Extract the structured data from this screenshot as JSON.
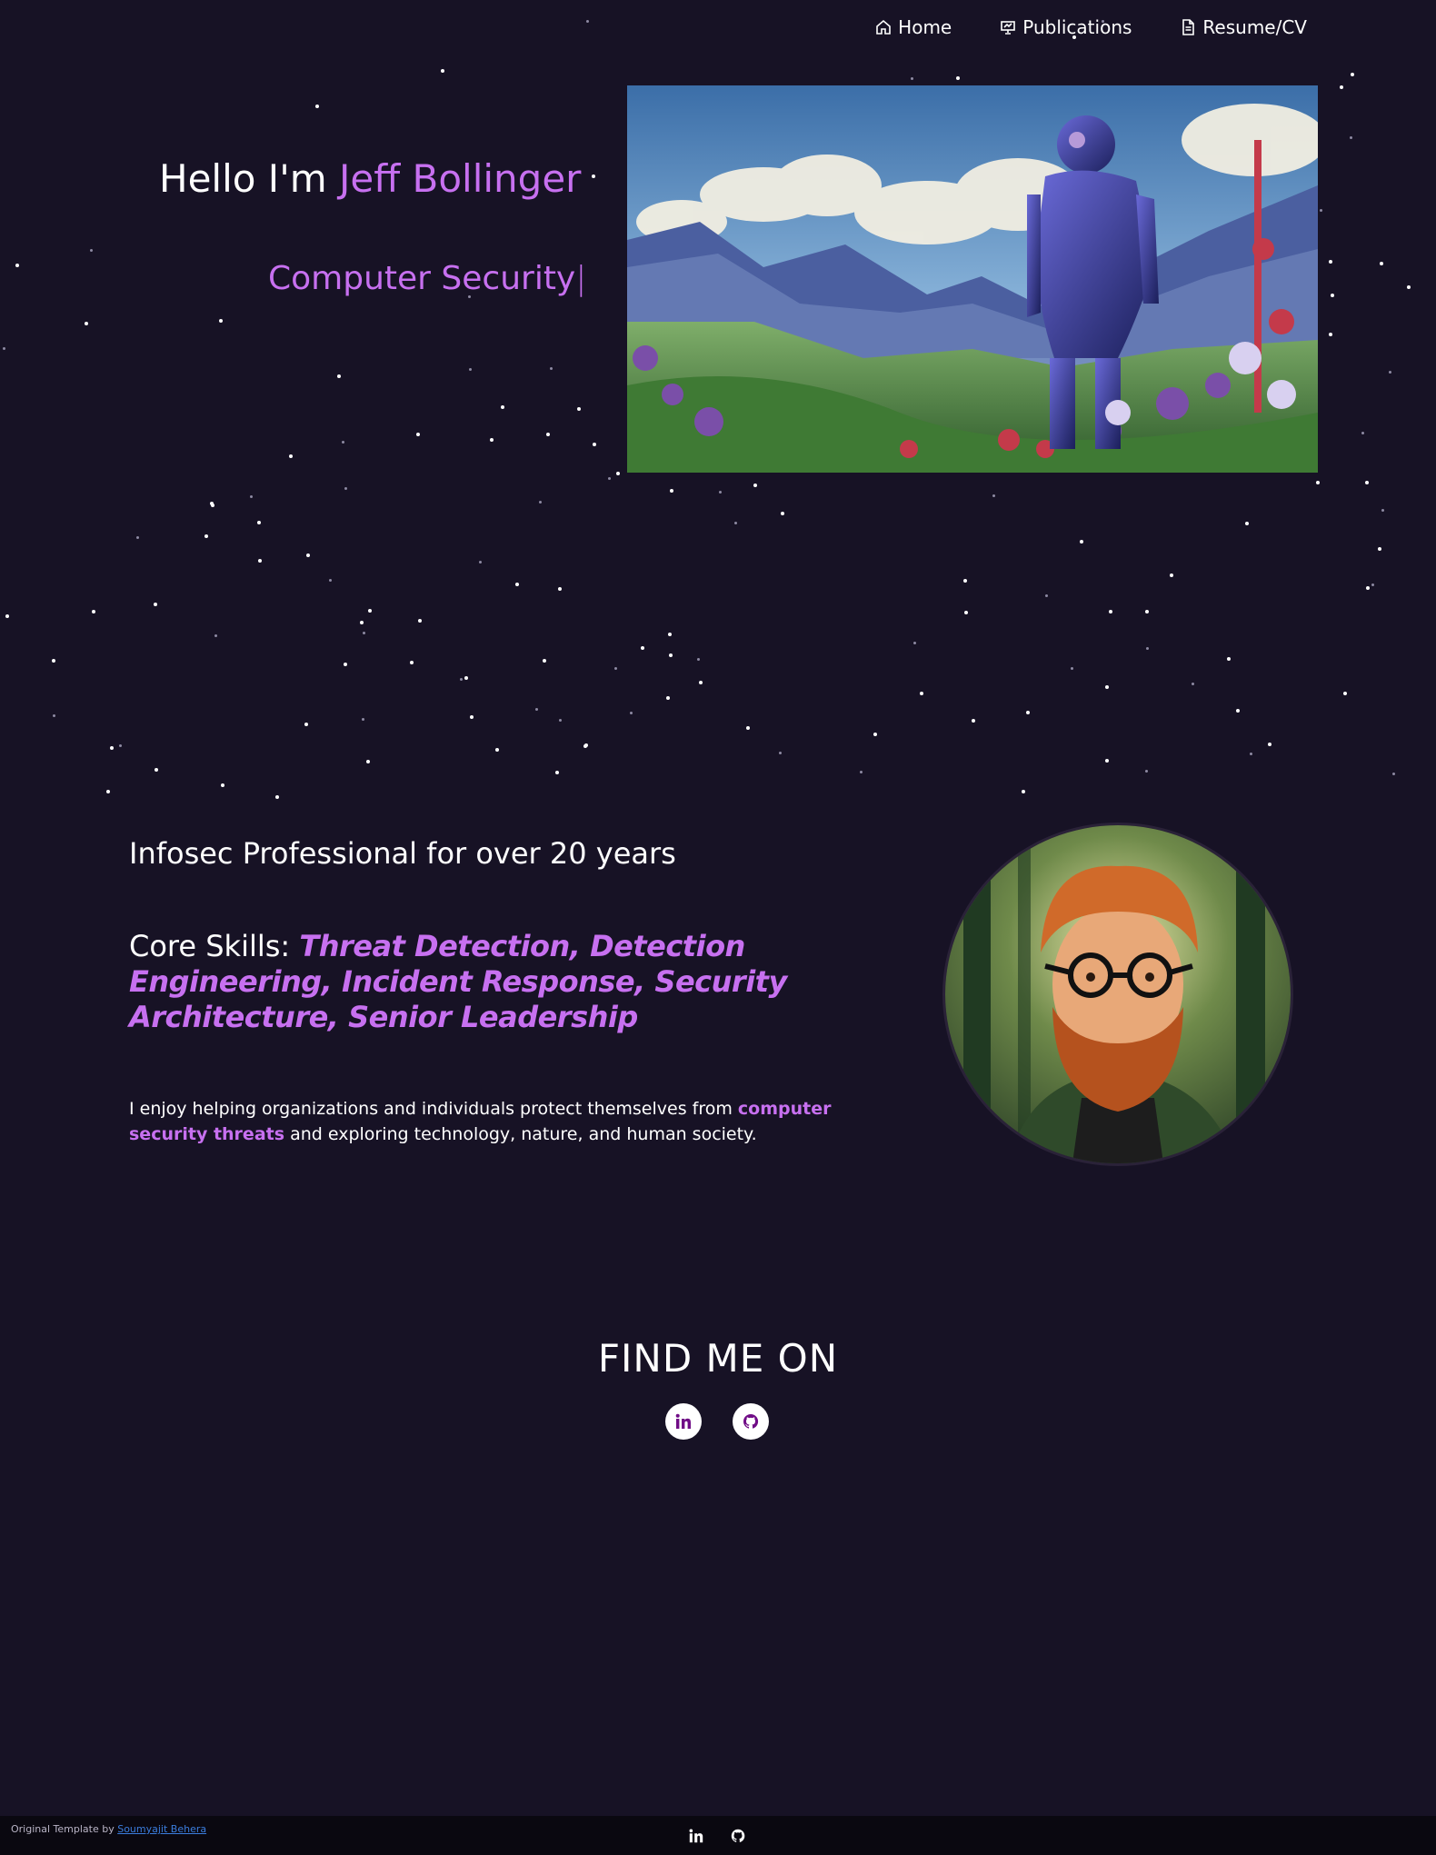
{
  "nav": {
    "items": [
      {
        "label": "Home",
        "icon": "home-icon"
      },
      {
        "label": "Publications",
        "icon": "presentation-icon"
      },
      {
        "label": "Resume/CV",
        "icon": "document-icon"
      }
    ]
  },
  "hero": {
    "greeting": "Hello I'm ",
    "name": "Jeff Bollinger",
    "typewriter_text": "Computer Security",
    "cursor": "|"
  },
  "about": {
    "headline": "Infosec Professional for over 20 years",
    "skills_label": "Core Skills: ",
    "skills_list": "Threat Detection, Detection Engineering, Incident Response, Security Architecture, Senior Leadership",
    "enjoy_prefix": "I enjoy helping organizations and individuals protect themselves from ",
    "enjoy_highlight": "computer security threats",
    "enjoy_suffix": " and exploring technology, nature, and human society."
  },
  "findme": {
    "title": "FIND ME ON",
    "links": [
      {
        "name": "linkedin",
        "icon": "linkedin-icon"
      },
      {
        "name": "github",
        "icon": "github-icon"
      }
    ]
  },
  "footer": {
    "credit_prefix": "Original Template by ",
    "credit_author": "Soumyajit Behera"
  },
  "colors": {
    "background": "#171225",
    "accent": "#c770f0",
    "footer_bg": "#0a0810",
    "link": "#3b7ddd"
  }
}
